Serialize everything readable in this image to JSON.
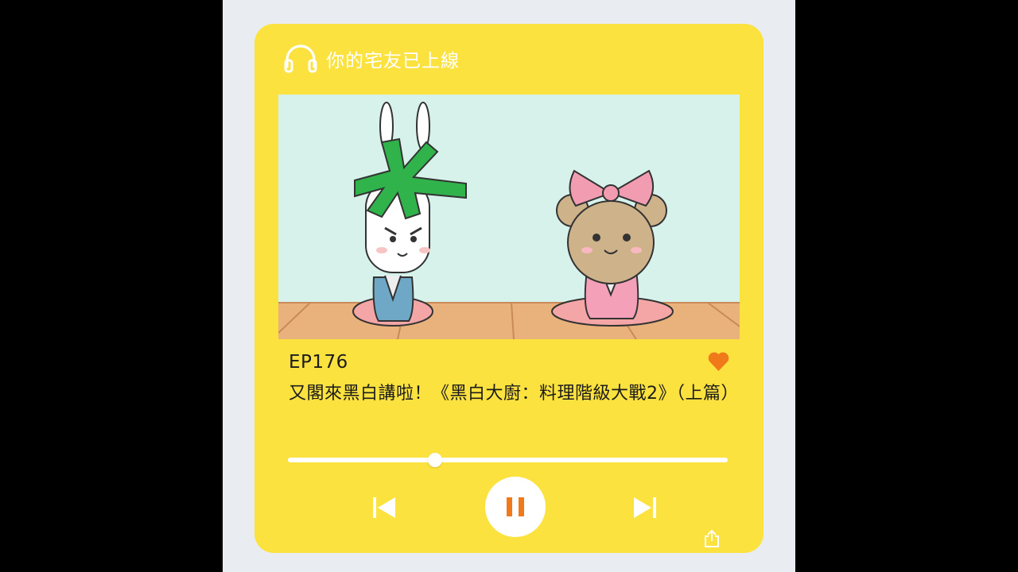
{
  "header": {
    "icon": "headphones-icon",
    "title": "你的宅友已上線"
  },
  "episode": {
    "number": "EP176",
    "title": "又閣來黑白講啦！《黑白大廚：料理階級大戰2》（上篇）",
    "liked": true
  },
  "player": {
    "progress_fraction": 0.335,
    "controls": [
      "previous-icon",
      "pause-icon",
      "next-icon",
      "share-icon"
    ]
  },
  "colors": {
    "card": "#fce23e",
    "accent": "#f07a1a",
    "background": "#e9ecf1"
  }
}
